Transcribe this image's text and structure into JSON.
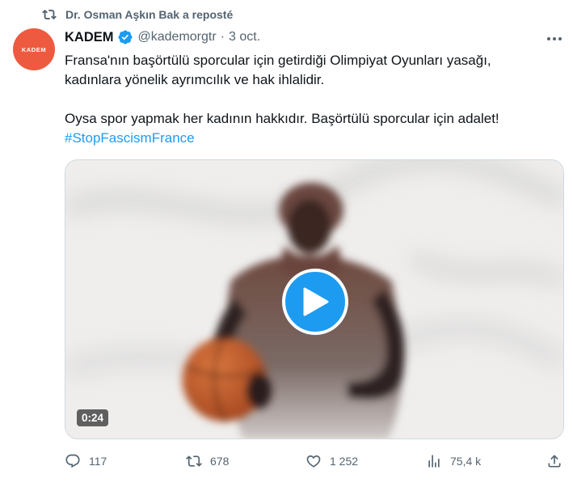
{
  "repost": {
    "text": "Dr. Osman Aşkın Bak a reposté",
    "icon": "repost-icon"
  },
  "author": {
    "avatar_text": "KADEM",
    "name": "KADEM",
    "handle": "@kademorgtr",
    "separator": "·",
    "date": "3 oct.",
    "verified_icon": "verified-badge-icon",
    "avatar_color": "#ee5a3f"
  },
  "tweet": {
    "line1": "Fransa'nın başörtülü sporcular için getirdiği Olimpiyat Oyunları yasağı,",
    "line2": "kadınlara yönelik ayrımcılık ve hak ihlalidir.",
    "line3": "Oysa spor yapmak her kadının hakkıdır. Başörtülü sporcular için adalet!",
    "hashtag": "#StopFascismFrance"
  },
  "media": {
    "duration": "0:24",
    "play_icon": "play-icon"
  },
  "actions": {
    "replies": "117",
    "reposts": "678",
    "likes": "1 252",
    "views": "75,4 k"
  },
  "colors": {
    "accent": "#1d9bf0",
    "muted": "#536471",
    "text": "#0f1419"
  }
}
